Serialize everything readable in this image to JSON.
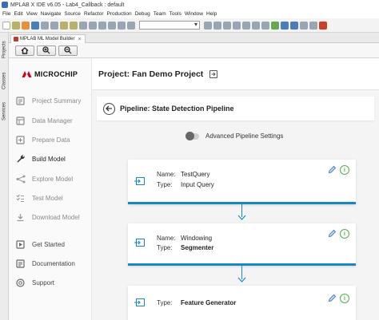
{
  "window": {
    "title": "MPLAB X IDE v6.05 - Lab4_Callback : default"
  },
  "menu": [
    "File",
    "Edit",
    "View",
    "Navigate",
    "Source",
    "Refactor",
    "Production",
    "Debug",
    "Team",
    "Tools",
    "Window",
    "Help"
  ],
  "side_dock": {
    "tabs": [
      "Projects",
      "Classes",
      "Services"
    ]
  },
  "doc_tab": {
    "label": "MPLAB ML Model Builder",
    "close": "×"
  },
  "brand": {
    "name": "MICROCHIP"
  },
  "sidebar": {
    "items": [
      {
        "label": "Project Summary",
        "icon": "summary-icon"
      },
      {
        "label": "Data Manager",
        "icon": "data-icon"
      },
      {
        "label": "Prepare Data",
        "icon": "prepare-icon"
      },
      {
        "label": "Build Model",
        "icon": "wrench-icon"
      },
      {
        "label": "Explore Model",
        "icon": "explore-icon"
      },
      {
        "label": "Test Model",
        "icon": "test-icon"
      },
      {
        "label": "Download Model",
        "icon": "download-icon"
      },
      {
        "label": "Get Started",
        "icon": "get-started-icon"
      },
      {
        "label": "Documentation",
        "icon": "documentation-icon"
      },
      {
        "label": "Support",
        "icon": "support-icon"
      }
    ]
  },
  "project": {
    "title": "Project: Fan Demo Project"
  },
  "pipeline": {
    "title": "Pipeline: State Detection Pipeline",
    "advanced_label": "Advanced Pipeline Settings",
    "steps": [
      {
        "name_key": "Name:",
        "name": "TestQuery",
        "type_key": "Type:",
        "type": "Input Query"
      },
      {
        "name_key": "Name:",
        "name": "Windowing",
        "type_key": "Type:",
        "type": "Segmenter"
      },
      {
        "type_key": "Type:",
        "type": "Feature Generator"
      }
    ]
  },
  "colors": {
    "accent": "#1b87c2",
    "info": "#4caf50",
    "brand_red": "#d0021b"
  }
}
